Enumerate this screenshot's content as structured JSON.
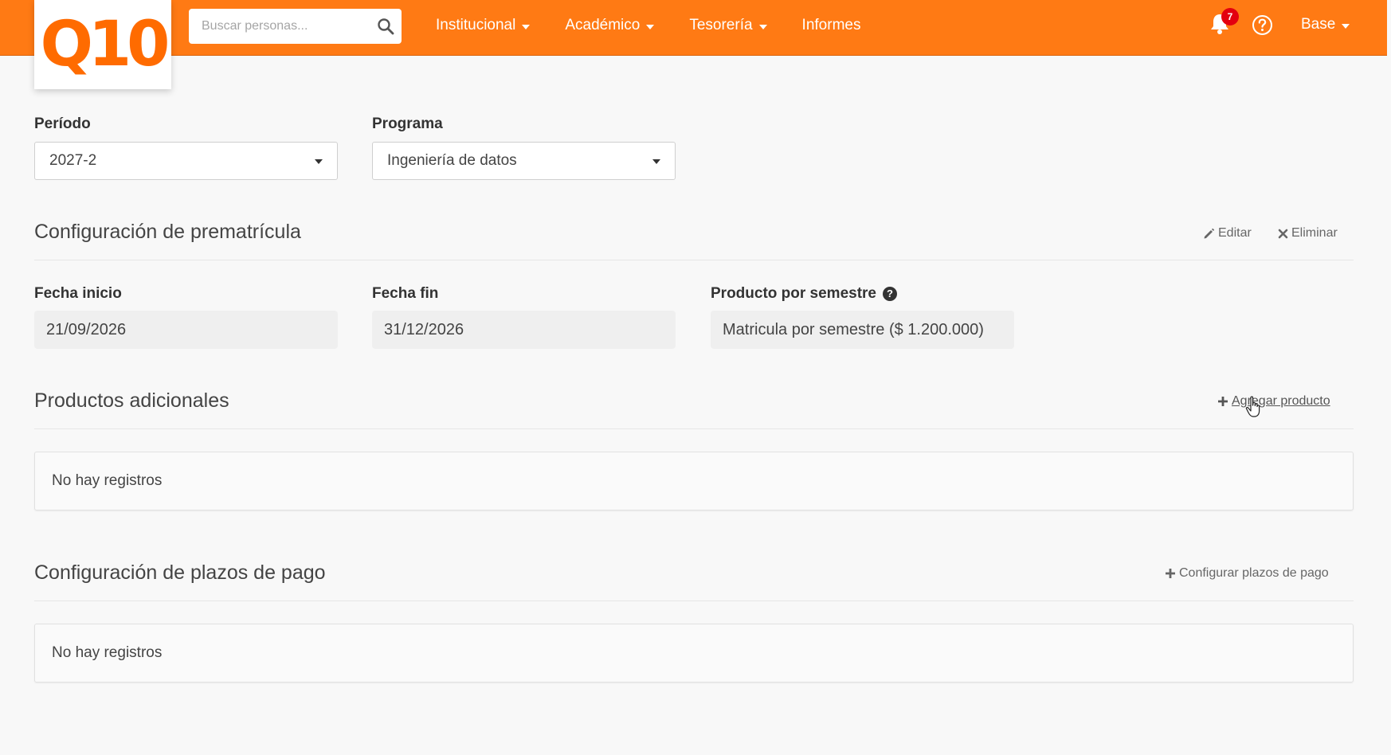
{
  "header": {
    "logo_text": "Q10",
    "search": {
      "placeholder": "Buscar personas..."
    },
    "nav": [
      {
        "label": "Institucional"
      },
      {
        "label": "Académico"
      },
      {
        "label": "Tesorería"
      },
      {
        "label": "Informes"
      }
    ],
    "notifications_count": "7",
    "user_menu": "Base",
    "accent_color": "#ff7a14"
  },
  "filters": {
    "periodo_label": "Período",
    "periodo_value": "2027-2",
    "programa_label": "Programa",
    "programa_value": "Ingeniería de datos"
  },
  "prematricula": {
    "title": "Configuración de prematrícula",
    "edit_label": "Editar",
    "delete_label": "Eliminar",
    "fecha_inicio_label": "Fecha inicio",
    "fecha_inicio_value": "21/09/2026",
    "fecha_fin_label": "Fecha fin",
    "fecha_fin_value": "31/12/2026",
    "producto_label": "Producto por semestre",
    "producto_value": "Matricula por semestre ($ 1.200.000)"
  },
  "productos_adicionales": {
    "title": "Productos adicionales",
    "add_label": "Agregar producto",
    "empty_text": "No hay registros"
  },
  "plazos_pago": {
    "title": "Configuración de plazos de pago",
    "config_label": "Configurar plazos de pago",
    "empty_text": "No hay registros"
  }
}
